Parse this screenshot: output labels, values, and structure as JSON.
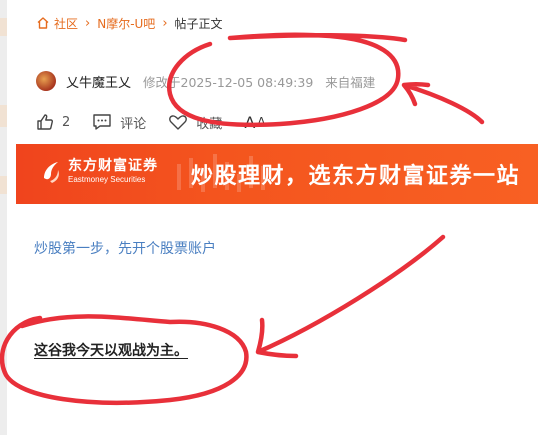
{
  "breadcrumb": {
    "home": "社区",
    "section": "N摩尔-U吧",
    "current": "帖子正文"
  },
  "author": {
    "name": "乂牛魔王乂",
    "modified": "修改于2025-12-05 08:49:39",
    "location": "来自福建"
  },
  "actions": {
    "like_count": "2",
    "comment": "评论",
    "favorite": "收藏",
    "font_big": "A",
    "font_small": "A"
  },
  "banner": {
    "logo_cn": "东方财富证券",
    "logo_en": "Eastmoney Securities",
    "slogan": "炒股理财，选东方财富证券一站"
  },
  "post": {
    "link": "炒股第一步，先开个股票账户",
    "text": "这谷我今天以观战为主。"
  },
  "colors": {
    "accent": "#e66c1f",
    "banner": "#f4551e",
    "link": "#4a7fc1",
    "annotation": "#e8303a"
  }
}
